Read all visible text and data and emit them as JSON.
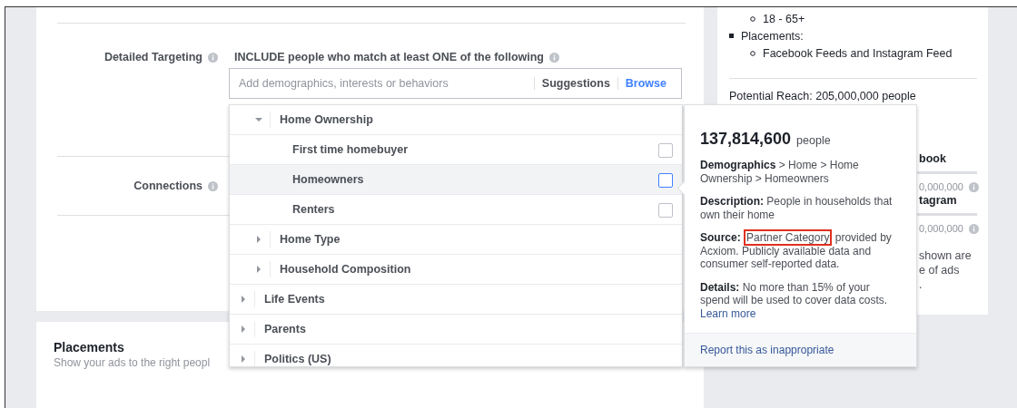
{
  "targeting": {
    "label": "Detailed Targeting",
    "include_text": "INCLUDE people who match at least ONE of the following",
    "search": {
      "placeholder": "Add demographics, interests or behaviors"
    },
    "tabs": [
      {
        "label": "Suggestions",
        "selected": false
      },
      {
        "label": "Browse",
        "selected": true
      }
    ]
  },
  "connections": {
    "label": "Connections"
  },
  "browse_list": {
    "items": [
      {
        "children": [
          {
            "label": "Home Ownership",
            "expanded": true,
            "children": [
              {
                "label": "First time homebuyer",
                "checked": false,
                "highlighted": false
              },
              {
                "label": "Homeowners",
                "checked": false,
                "highlighted": true
              },
              {
                "label": "Renters",
                "checked": false,
                "highlighted": false
              }
            ]
          },
          {
            "label": "Home Type",
            "expanded": false
          },
          {
            "label": "Household Composition",
            "expanded": false
          }
        ]
      },
      {
        "label": "Life Events",
        "expanded": false
      },
      {
        "label": "Parents",
        "expanded": false
      },
      {
        "label": "Politics (US)",
        "expanded": false
      }
    ]
  },
  "tooltip": {
    "count": "137,814,600",
    "unit": "people",
    "path": "**Demographics** > Home > Home Ownership > Homeowners",
    "description": "**Description:** People in households that own their home",
    "source": {
      "label": "Source:",
      "highlighted": "Partner Category",
      "rest": "provided by Acxiom. Publicly available data and consumer self-reported data."
    },
    "details": "**Details:** No more than 15% of your spend will be used to cover data costs.",
    "details_link": "Learn more",
    "footer_link": "Report this as inappropriate"
  },
  "placements": {
    "title": "Placements",
    "subtitle": "Show your ads to the right peopl"
  },
  "summary": {
    "items": [
      {
        "kind": "circle",
        "text": "18 - 65+"
      },
      {
        "kind": "square",
        "text": "Placements:"
      },
      {
        "kind": "circle",
        "text": "Facebook Feeds and Instagram Feed"
      }
    ],
    "reach": "Potential Reach: 205,000,000 people",
    "fragments": [
      {
        "kind": "heading",
        "text": "book"
      },
      {
        "kind": "bar"
      },
      {
        "kind": "figure",
        "text": "0,000,000"
      },
      {
        "kind": "heading",
        "text": "tagram"
      },
      {
        "kind": "bar"
      },
      {
        "kind": "figure",
        "text": "0,000,000"
      },
      {
        "kind": "text",
        "text": "shown are"
      },
      {
        "kind": "text",
        "text": "e of ads"
      },
      {
        "kind": "text",
        "text": "."
      }
    ]
  }
}
